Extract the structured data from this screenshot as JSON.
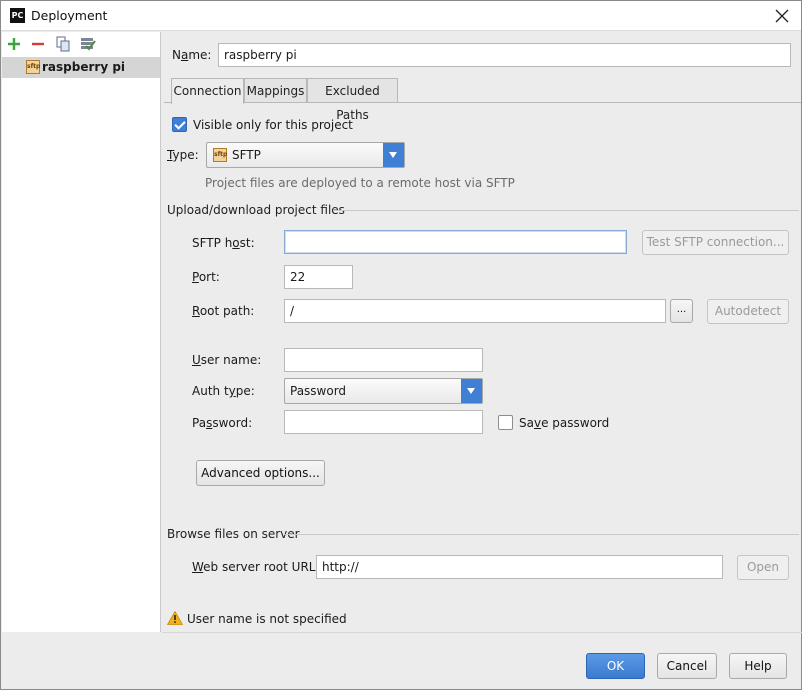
{
  "window": {
    "title": "Deployment",
    "app_icon_text": "PC"
  },
  "sidebar": {
    "toolbar": [
      {
        "name": "add-icon",
        "color": "#3aa53a"
      },
      {
        "name": "remove-icon",
        "color": "#d43b3b"
      },
      {
        "name": "copy-icon",
        "color": "#5a6e8c"
      },
      {
        "name": "use-as-default-icon",
        "color": "#4e8f3c"
      }
    ],
    "servers": [
      {
        "label": "raspberry pi",
        "icon": "sftp-server-icon"
      }
    ]
  },
  "form": {
    "name_label_pre": "N",
    "name_label_u": "a",
    "name_label_post": "me:",
    "name_value": "raspberry pi",
    "tabs": [
      {
        "label": "Connection",
        "active": true
      },
      {
        "label": "Mappings",
        "active": false
      },
      {
        "label": "Excluded Paths",
        "active": false
      }
    ],
    "visible_only_label": "Visible only for this project",
    "visible_only_checked": true,
    "type_label_u": "T",
    "type_label_post": "ype:",
    "type_value": "SFTP",
    "type_badge": "sftp",
    "type_hint": "Project files are deployed to a remote host via SFTP",
    "upload_section_title": "Upload/download project files",
    "sftp_host_label_pre": "SFTP h",
    "sftp_host_label_u": "o",
    "sftp_host_label_post": "st:",
    "sftp_host_value": "",
    "test_connection_label": "Test SFTP connection...",
    "port_label_u": "P",
    "port_label_post": "ort:",
    "port_value": "22",
    "root_path_label_u": "R",
    "root_path_label_post": "oot path:",
    "root_path_value": "/",
    "browse_label": "...",
    "autodetect_label": "Autodetect",
    "user_name_label_pre": "",
    "user_name_label_u": "U",
    "user_name_label_post": "ser name:",
    "user_name_value": "",
    "auth_type_label_pre": "Auth t",
    "auth_type_label_u": "y",
    "auth_type_label_post": "pe:",
    "auth_type_value": "Password",
    "password_label_pre": "Pa",
    "password_label_u": "s",
    "password_label_post": "sword:",
    "password_value": "",
    "save_password_label_pre": "Sa",
    "save_password_label_u": "v",
    "save_password_label_post": "e password",
    "save_password_checked": false,
    "advanced_options_label": "Advanced options...",
    "browse_section_title": "Browse files on server",
    "web_root_label_u": "W",
    "web_root_label_post": "eb server root URL:",
    "web_root_value": "http://",
    "open_label": "Open",
    "warning_text": "User name is not specified"
  },
  "footer": {
    "ok_label": "OK",
    "cancel_label": "Cancel",
    "help_label": "Help"
  },
  "colors": {
    "accent": "#3f7fd4",
    "warning": "#f2b01e"
  }
}
